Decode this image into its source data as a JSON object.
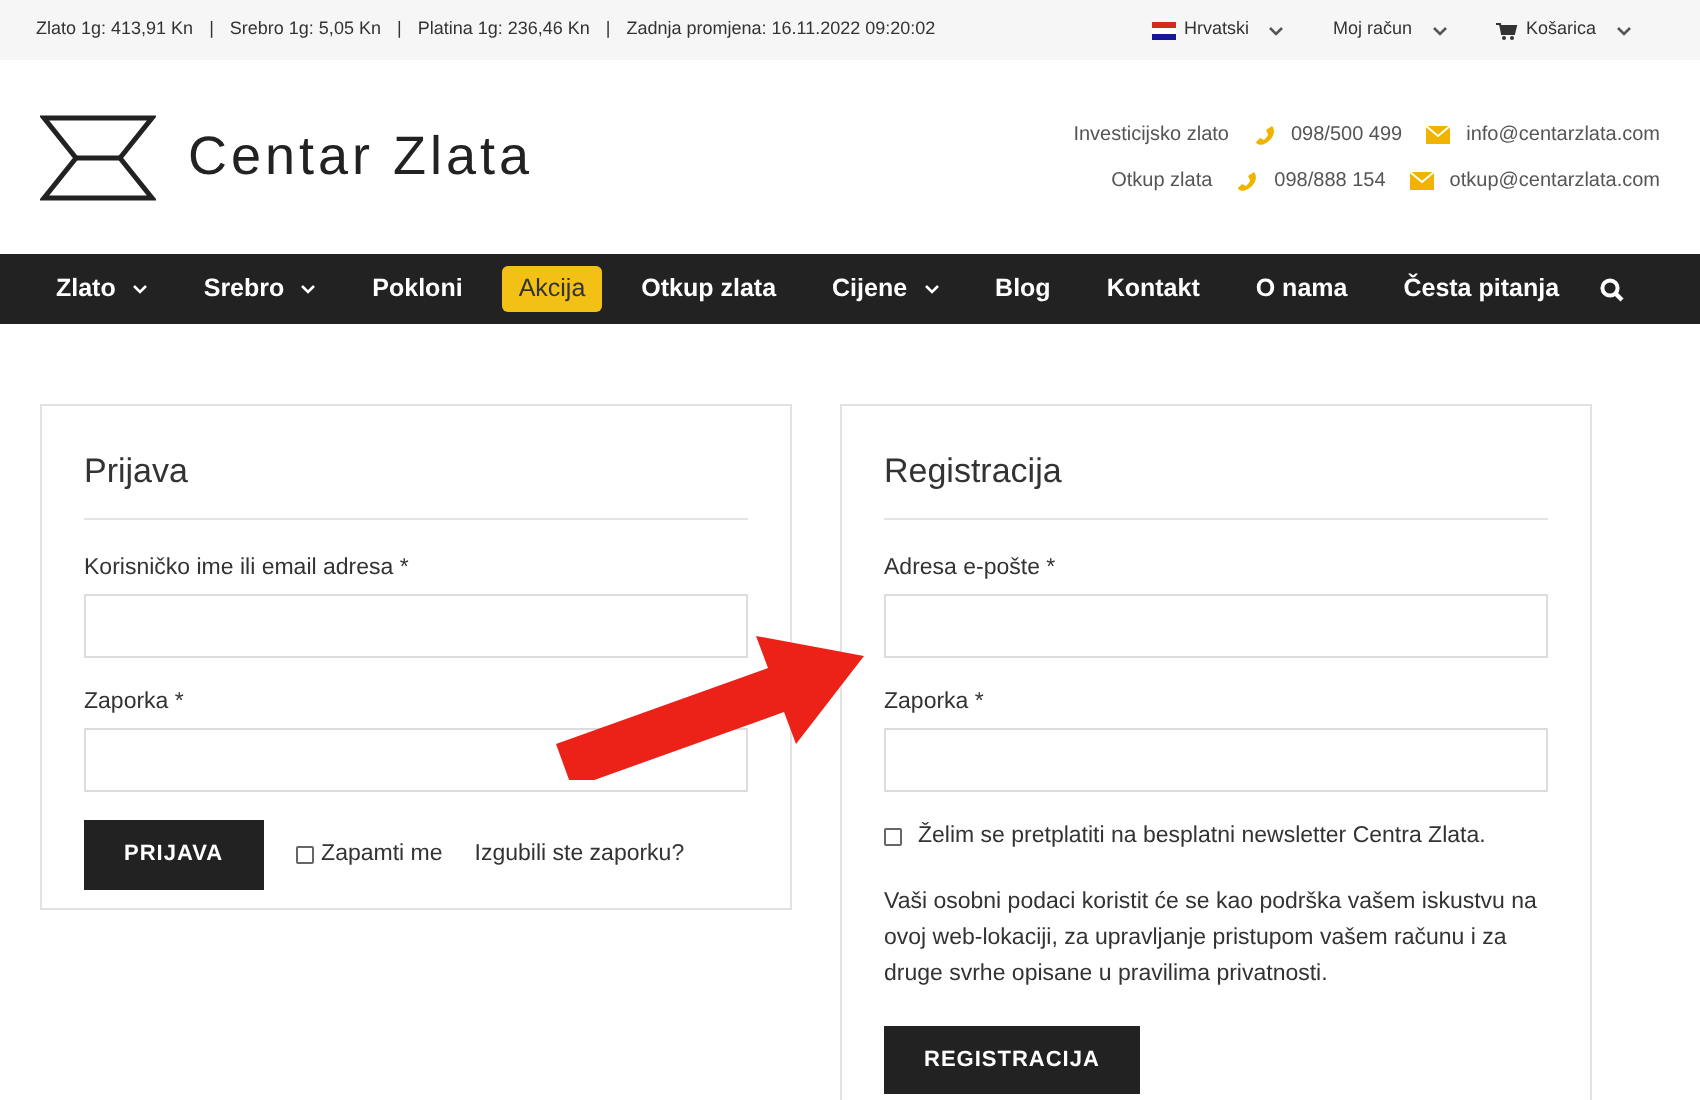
{
  "top_bar": {
    "prices": [
      "Zlato 1g: 413,91 Kn",
      "Srebro 1g: 5,05 Kn",
      "Platina 1g: 236,46 Kn",
      "Zadnja promjena: 16.11.2022 09:20:02"
    ],
    "separator": "|",
    "menus": [
      {
        "label": "Hrvatski",
        "kind": "language"
      },
      {
        "label": "Moj račun",
        "kind": "account"
      },
      {
        "label": "Košarica",
        "kind": "cart"
      }
    ]
  },
  "header": {
    "logo": "Centar Zlata",
    "contacts": [
      {
        "label": "Investicijsko zlato",
        "phone": "098/500 499",
        "email": "info@centarzlata.com"
      },
      {
        "label": "Otkup zlata",
        "phone": "098/888 154",
        "email": "otkup@centarzlata.com"
      }
    ]
  },
  "nav": [
    {
      "label": "Zlato",
      "dropdown": true,
      "highlighted": false
    },
    {
      "label": "Srebro",
      "dropdown": true,
      "highlighted": false
    },
    {
      "label": "Pokloni",
      "dropdown": false,
      "highlighted": false
    },
    {
      "label": "Akcija",
      "dropdown": false,
      "highlighted": true
    },
    {
      "label": "Otkup zlata",
      "dropdown": false,
      "highlighted": false
    },
    {
      "label": "Cijene",
      "dropdown": true,
      "highlighted": false
    },
    {
      "label": "Blog",
      "dropdown": false,
      "highlighted": false
    },
    {
      "label": "Kontakt",
      "dropdown": false,
      "highlighted": false
    },
    {
      "label": "O nama",
      "dropdown": false,
      "highlighted": false
    },
    {
      "label": "Česta pitanja",
      "dropdown": false,
      "highlighted": false
    }
  ],
  "login": {
    "title": "Prijava",
    "fields": [
      {
        "label": "Korisničko ime ili email adresa *"
      },
      {
        "label": "Zaporka *"
      }
    ],
    "button": "PRIJAVA",
    "remember": {
      "label": "Zapamti me",
      "checked": false
    },
    "lost_password": "Izgubili ste zaporku?"
  },
  "register": {
    "title": "Registracija",
    "fields": [
      {
        "label": "Adresa e-pošte *"
      },
      {
        "label": "Zaporka *"
      }
    ],
    "newsletter": {
      "label": "Želim se pretplatiti na besplatni newsletter Centra Zlata.",
      "checked": false
    },
    "privacy": "Vaši osobni podaci koristit će se kao podrška vašem iskustvu na ovoj web-lokaciji, za upravljanje pristupom vašem računu i za druge svrhe opisane u pravilima privatnosti.",
    "button": "REGISTRACIJA"
  }
}
